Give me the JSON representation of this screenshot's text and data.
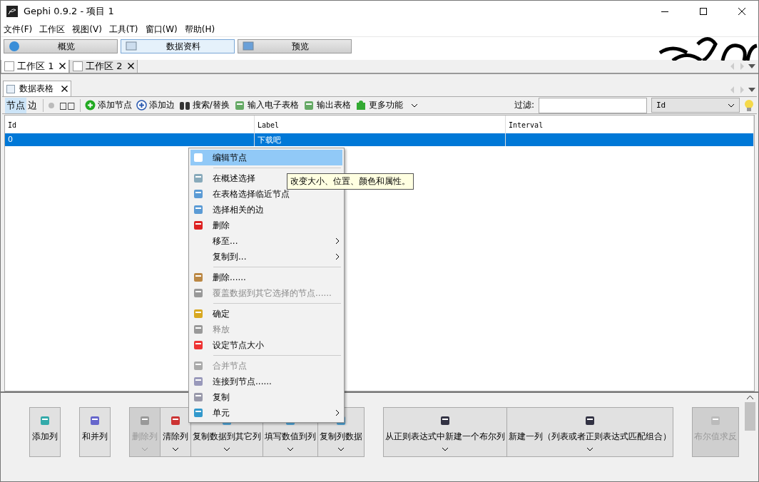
{
  "window": {
    "title": "Gephi 0.9.2 - 项目 1"
  },
  "menu_bar": [
    "文件(F)",
    "工作区",
    "视图(V)",
    "工具(T)",
    "窗口(W)",
    "帮助(H)"
  ],
  "perspectives": [
    {
      "label": "概览",
      "selected": false
    },
    {
      "label": "数据资料",
      "selected": true
    },
    {
      "label": "预览",
      "selected": false
    }
  ],
  "workspace_tabs": [
    {
      "label": "工作区 1",
      "selected": true
    },
    {
      "label": "工作区 2",
      "selected": false
    }
  ],
  "panel_tab": {
    "label": "数据表格"
  },
  "toolbar": {
    "view_toggle": [
      {
        "label": "节点",
        "selected": true
      },
      {
        "label": "边",
        "selected": false
      }
    ],
    "layout_toggle": "□□",
    "actions": [
      "添加节点",
      "添加边",
      "搜索/替换",
      "输入电子表格",
      "输出表格",
      "更多功能"
    ],
    "filter_label": "过滤:",
    "filter_column": "Id"
  },
  "table": {
    "columns": [
      "Id",
      "Label",
      "Interval"
    ],
    "rows": [
      {
        "cells": [
          "0",
          "下载吧",
          ""
        ],
        "selected": true
      }
    ]
  },
  "context_menu": [
    {
      "kind": "item",
      "label": "编辑节点",
      "highlighted": true,
      "disabled": false,
      "submenu": false
    },
    {
      "kind": "separator"
    },
    {
      "kind": "item",
      "label": "在概述选择",
      "highlighted": false,
      "disabled": false
    },
    {
      "kind": "item",
      "label": "在表格选择临近节点",
      "highlighted": false,
      "disabled": false,
      "submenu": false
    },
    {
      "kind": "item",
      "label": "选择相关的边",
      "highlighted": false,
      "disabled": false,
      "submenu": false
    },
    {
      "kind": "item",
      "label": "删除",
      "highlighted": false,
      "disabled": false,
      "submenu": false
    },
    {
      "kind": "item",
      "label": "移至...",
      "highlighted": false,
      "disabled": false,
      "submenu": true
    },
    {
      "kind": "item",
      "label": "复制到...",
      "highlighted": false,
      "disabled": false,
      "submenu": true
    },
    {
      "kind": "separator"
    },
    {
      "kind": "item",
      "label": "删除......",
      "highlighted": false,
      "disabled": false,
      "submenu": false
    },
    {
      "kind": "item",
      "label": "覆盖数据到其它选择的节点......",
      "highlighted": false,
      "disabled": true,
      "submenu": false
    },
    {
      "kind": "separator"
    },
    {
      "kind": "item",
      "label": "确定",
      "highlighted": false,
      "disabled": false,
      "submenu": false
    },
    {
      "kind": "item",
      "label": "释放",
      "highlighted": false,
      "disabled": true,
      "submenu": false
    },
    {
      "kind": "item",
      "label": "设定节点大小",
      "highlighted": false,
      "disabled": false,
      "submenu": false
    },
    {
      "kind": "separator"
    },
    {
      "kind": "item",
      "label": "合并节点",
      "highlighted": false,
      "disabled": true,
      "submenu": false
    },
    {
      "kind": "item",
      "label": "连接到节点......",
      "highlighted": false,
      "disabled": false,
      "submenu": false
    },
    {
      "kind": "item",
      "label": "复制",
      "highlighted": false,
      "disabled": false,
      "submenu": false
    },
    {
      "kind": "item",
      "label": "单元",
      "highlighted": false,
      "disabled": false,
      "submenu": true
    }
  ],
  "tooltip": "改变大小、位置、颜色和属性。",
  "column_buttons": [
    {
      "label": "添加列",
      "disabled": false,
      "dropdown": false
    },
    {
      "label": "和并列",
      "disabled": false,
      "dropdown": false
    },
    {
      "label": "删除列",
      "disabled": true,
      "dropdown": true
    },
    {
      "label": "清除列",
      "disabled": false,
      "dropdown": true
    },
    {
      "label": "复制数据到其它列",
      "disabled": false,
      "dropdown": true
    },
    {
      "label": "填写数值到列",
      "disabled": false,
      "dropdown": true
    },
    {
      "label": "复制列数据",
      "disabled": false,
      "dropdown": true
    },
    {
      "label": "从正则表达式中新建一个布尔列",
      "disabled": false,
      "dropdown": true
    },
    {
      "label": "新建一列（列表或者正则表达式匹配组合）",
      "disabled": false,
      "dropdown": true
    },
    {
      "label": "布尔值求反",
      "disabled": true,
      "dropdown": false
    }
  ]
}
